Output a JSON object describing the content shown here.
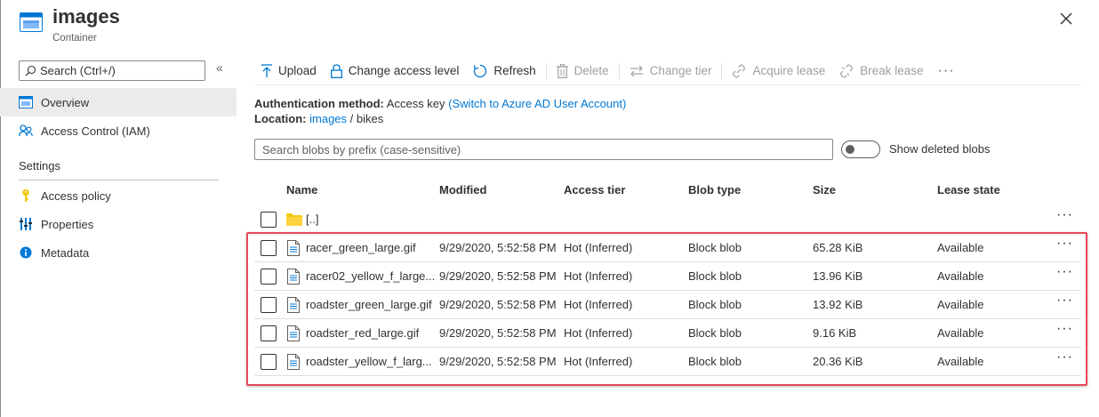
{
  "header": {
    "title": "images",
    "subtitle": "Container",
    "icon": "storage-container-icon",
    "close_icon": "close-icon"
  },
  "sidebar": {
    "search_placeholder": "Search (Ctrl+/)",
    "collapse_label": "«",
    "items": [
      {
        "label": "Overview",
        "icon": "overview-icon",
        "active": true
      },
      {
        "label": "Access Control (IAM)",
        "icon": "people-icon",
        "active": false
      }
    ],
    "section_title": "Settings",
    "settings_items": [
      {
        "label": "Access policy",
        "icon": "key-icon"
      },
      {
        "label": "Properties",
        "icon": "properties-icon"
      },
      {
        "label": "Metadata",
        "icon": "info-icon"
      }
    ]
  },
  "toolbar": {
    "upload": "Upload",
    "change_access_level": "Change access level",
    "refresh": "Refresh",
    "delete": "Delete",
    "change_tier": "Change tier",
    "acquire_lease": "Acquire lease",
    "break_lease": "Break lease",
    "more": "···"
  },
  "info": {
    "auth_label": "Authentication method:",
    "auth_value": "Access key",
    "auth_link": "(Switch to Azure AD User Account)",
    "location_label": "Location:",
    "location_link": "images",
    "location_sep": "/",
    "location_folder": "bikes"
  },
  "blob_search": {
    "placeholder": "Search blobs by prefix (case-sensitive)",
    "toggle_label": "Show deleted blobs",
    "toggle_on": false
  },
  "table": {
    "headers": {
      "name": "Name",
      "modified": "Modified",
      "access_tier": "Access tier",
      "blob_type": "Blob type",
      "size": "Size",
      "lease_state": "Lease state"
    },
    "parent_row": {
      "name": "[..]",
      "icon": "folder-icon"
    },
    "rows": [
      {
        "name": "racer_green_large.gif",
        "modified": "9/29/2020, 5:52:58 PM",
        "tier": "Hot (Inferred)",
        "type": "Block blob",
        "size": "65.28 KiB",
        "lease": "Available"
      },
      {
        "name": "racer02_yellow_f_large...",
        "modified": "9/29/2020, 5:52:58 PM",
        "tier": "Hot (Inferred)",
        "type": "Block blob",
        "size": "13.96 KiB",
        "lease": "Available"
      },
      {
        "name": "roadster_green_large.gif",
        "modified": "9/29/2020, 5:52:58 PM",
        "tier": "Hot (Inferred)",
        "type": "Block blob",
        "size": "13.92 KiB",
        "lease": "Available"
      },
      {
        "name": "roadster_red_large.gif",
        "modified": "9/29/2020, 5:52:58 PM",
        "tier": "Hot (Inferred)",
        "type": "Block blob",
        "size": "9.16 KiB",
        "lease": "Available"
      },
      {
        "name": "roadster_yellow_f_larg...",
        "modified": "9/29/2020, 5:52:58 PM",
        "tier": "Hot (Inferred)",
        "type": "Block blob",
        "size": "20.36 KiB",
        "lease": "Available"
      }
    ],
    "row_more": "···"
  },
  "colors": {
    "accent": "#0078d4",
    "highlight_border": "#e74856",
    "folder": "#f2c811"
  }
}
